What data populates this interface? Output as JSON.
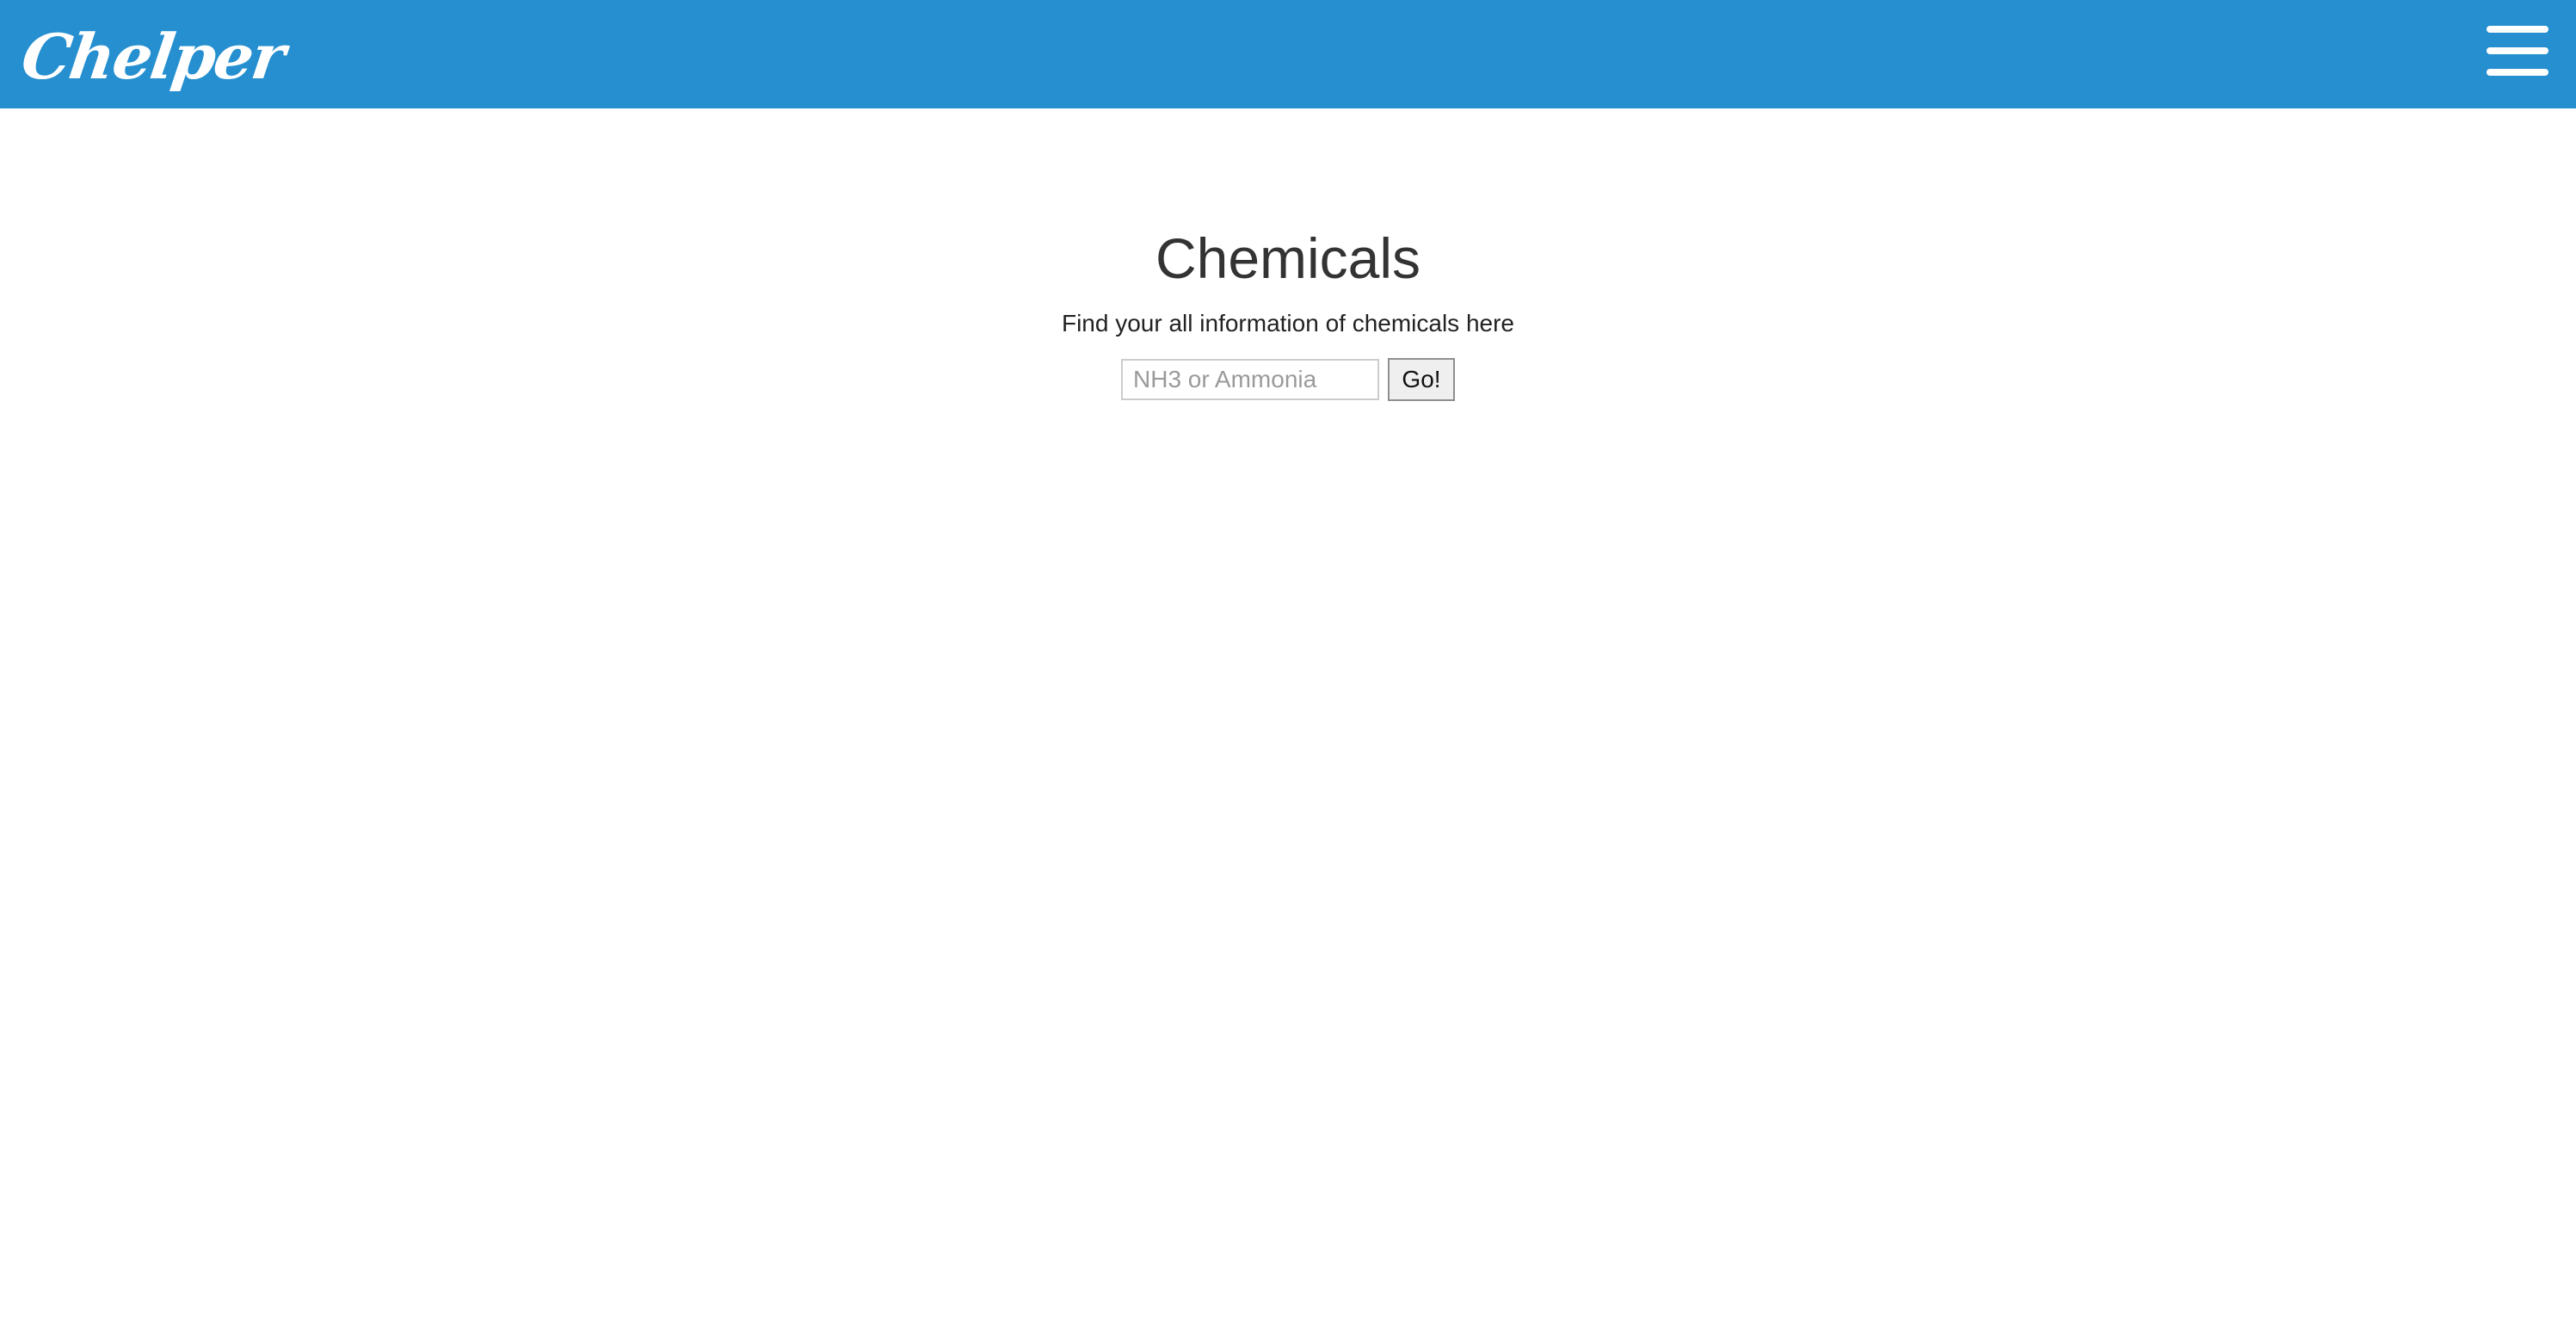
{
  "header": {
    "logo_text": "Chelper",
    "menu_icon": "hamburger-menu-icon",
    "background_color": "#258fd0"
  },
  "main": {
    "title": "Chemicals",
    "subtitle": "Find your all information of chemicals here",
    "search": {
      "placeholder": "NH3 or Ammonia",
      "value": "",
      "button_label": "Go!"
    }
  }
}
